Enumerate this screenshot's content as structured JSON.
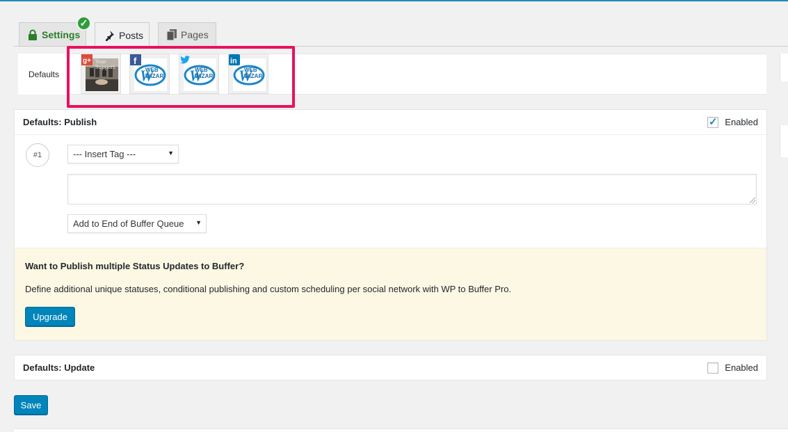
{
  "tabs": [
    {
      "label": "Settings",
      "icon": "lock-icon",
      "status": "check-icon"
    },
    {
      "label": "Posts",
      "icon": "pin-icon"
    },
    {
      "label": "Pages",
      "icon": "pages-icon"
    }
  ],
  "profiles": {
    "defaults_label": "Defaults",
    "items": [
      {
        "network": "google-plus",
        "network_color": "#dd4b39",
        "avatar_text": "Your Support"
      },
      {
        "network": "facebook",
        "network_color": "#3b5998",
        "avatar_text": "WEB WIZAR"
      },
      {
        "network": "twitter",
        "network_color": "#1da1f2",
        "avatar_text": "WEB WIZAR"
      },
      {
        "network": "linkedin",
        "network_color": "#0077b5",
        "avatar_text": "WEB WIZAR"
      }
    ]
  },
  "publish_panel": {
    "title": "Defaults: Publish",
    "enabled_label": "Enabled",
    "enabled": true,
    "status_number": "#1",
    "insert_tag": "--- Insert Tag ---",
    "status_text": "",
    "queue_option": "Add to End of Buffer Queue"
  },
  "upsell": {
    "heading": "Want to Publish multiple Status Updates to Buffer?",
    "body": "Define additional unique statuses, conditional publishing and custom scheduling per social network with WP to Buffer Pro.",
    "button": "Upgrade"
  },
  "update_panel": {
    "title": "Defaults: Update",
    "enabled_label": "Enabled",
    "enabled": false
  },
  "save_label": "Save",
  "colors": {
    "accent": "#0085ba",
    "highlight": "#e8115f",
    "success": "#2e9e3a",
    "upsell_bg": "#fdf8e4"
  }
}
